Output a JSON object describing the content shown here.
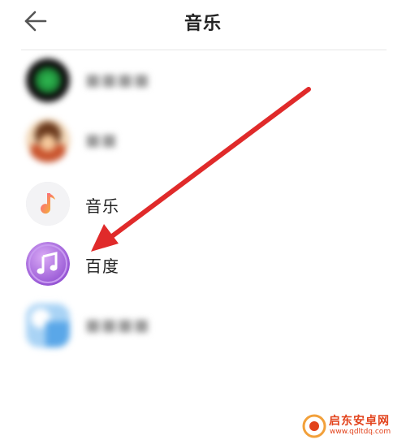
{
  "header": {
    "title": "音乐",
    "back_icon": "arrow-left-icon"
  },
  "apps": [
    {
      "label": "",
      "blurred": true,
      "icon": "blurred-green-app-icon",
      "color": "#1e8f3a"
    },
    {
      "label": "",
      "blurred": true,
      "icon": "blurred-character-app-icon",
      "color": "#c9552f"
    },
    {
      "label": "音乐",
      "blurred": false,
      "icon": "music-note-icon",
      "color": "#f2f2f4"
    },
    {
      "label": "百度",
      "blurred": false,
      "icon": "music-notes-purple-icon",
      "color": "#9b59d6"
    },
    {
      "label": "",
      "blurred": true,
      "icon": "blurred-blue-app-icon",
      "color": "#5aa7e8"
    }
  ],
  "annotation": {
    "icon": "red-arrow-icon",
    "color": "#e02a2a"
  },
  "watermark": {
    "name": "启东安卓网",
    "url": "www.qdltdq.com",
    "color": "#e2421b"
  }
}
